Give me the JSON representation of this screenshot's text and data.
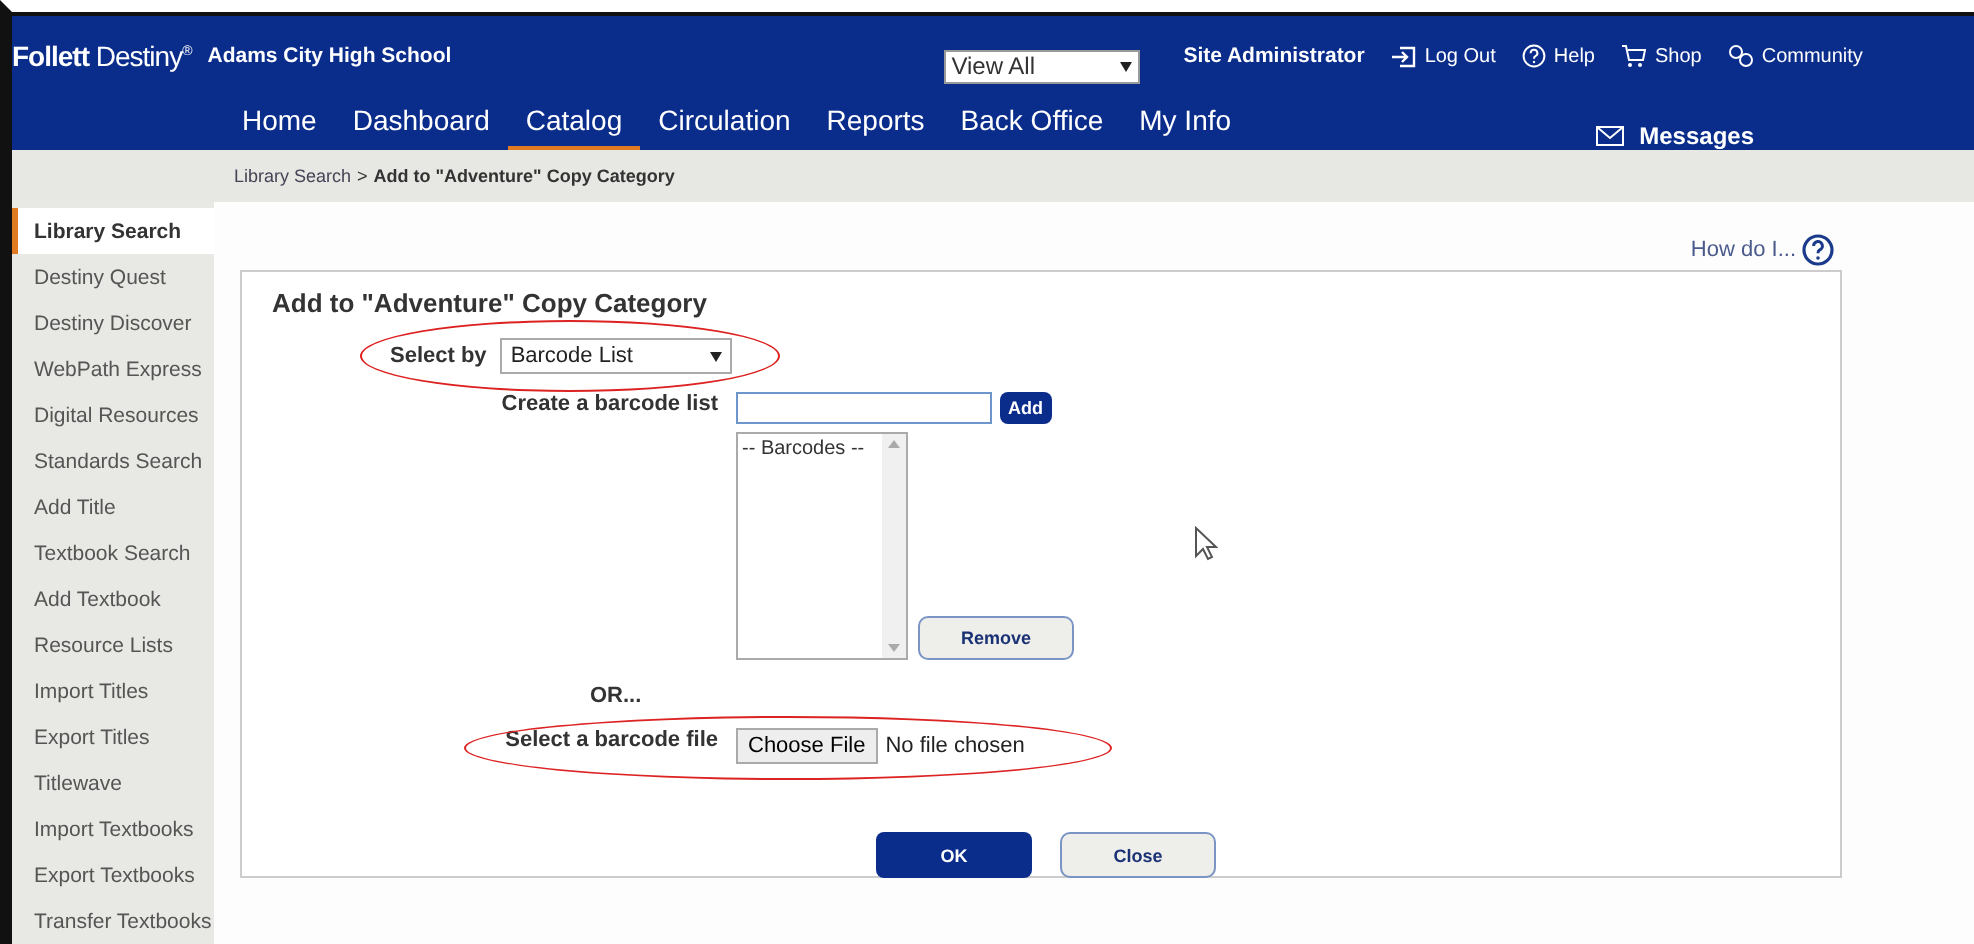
{
  "header": {
    "logo_bold": "Follett",
    "logo_rest": "Destiny",
    "logo_mark": "®",
    "school": "Adams City High School",
    "site_select": "View All",
    "user": "Site Administrator",
    "links": [
      {
        "kind": "logout",
        "label": "Log Out"
      },
      {
        "kind": "help",
        "label": "Help"
      },
      {
        "kind": "shop",
        "label": "Shop"
      },
      {
        "kind": "community",
        "label": "Community"
      }
    ],
    "tabs": [
      {
        "label": "Home",
        "selected": false
      },
      {
        "label": "Dashboard",
        "selected": false
      },
      {
        "label": "Catalog",
        "selected": true
      },
      {
        "label": "Circulation",
        "selected": false
      },
      {
        "label": "Reports",
        "selected": false
      },
      {
        "label": "Back Office",
        "selected": false
      },
      {
        "label": "My Info",
        "selected": false
      }
    ],
    "messages": "Messages"
  },
  "breadcrumb": {
    "link": "Library Search",
    "separator": ">",
    "current": "Add to \"Adventure\" Copy Category"
  },
  "sidebar": {
    "items": [
      {
        "label": "Library Search",
        "selected": true
      },
      {
        "label": "Destiny Quest",
        "selected": false
      },
      {
        "label": "Destiny Discover",
        "selected": false
      },
      {
        "label": "WebPath Express",
        "selected": false
      },
      {
        "label": "Digital Resources",
        "selected": false
      },
      {
        "label": "Standards Search",
        "selected": false
      },
      {
        "label": "Add Title",
        "selected": false
      },
      {
        "label": "Textbook Search",
        "selected": false
      },
      {
        "label": "Add Textbook",
        "selected": false
      },
      {
        "label": "Resource Lists",
        "selected": false
      },
      {
        "label": "Import Titles",
        "selected": false
      },
      {
        "label": "Export Titles",
        "selected": false
      },
      {
        "label": "Titlewave",
        "selected": false
      },
      {
        "label": "Import Textbooks",
        "selected": false
      },
      {
        "label": "Export Textbooks",
        "selected": false
      },
      {
        "label": "Transfer Textbooks",
        "selected": false
      }
    ]
  },
  "how_do_i": "How do I...",
  "form": {
    "title": "Add to \"Adventure\" Copy Category",
    "select_by_label": "Select by",
    "select_by_value": "Barcode List",
    "create_label": "Create a barcode list",
    "add_button": "Add",
    "list_header": "-- Barcodes --",
    "remove_button": "Remove",
    "or": "OR...",
    "file_label": "Select a barcode file",
    "choose_file": "Choose File",
    "no_file": "No file chosen",
    "ok_button": "OK",
    "close_button": "Close"
  }
}
